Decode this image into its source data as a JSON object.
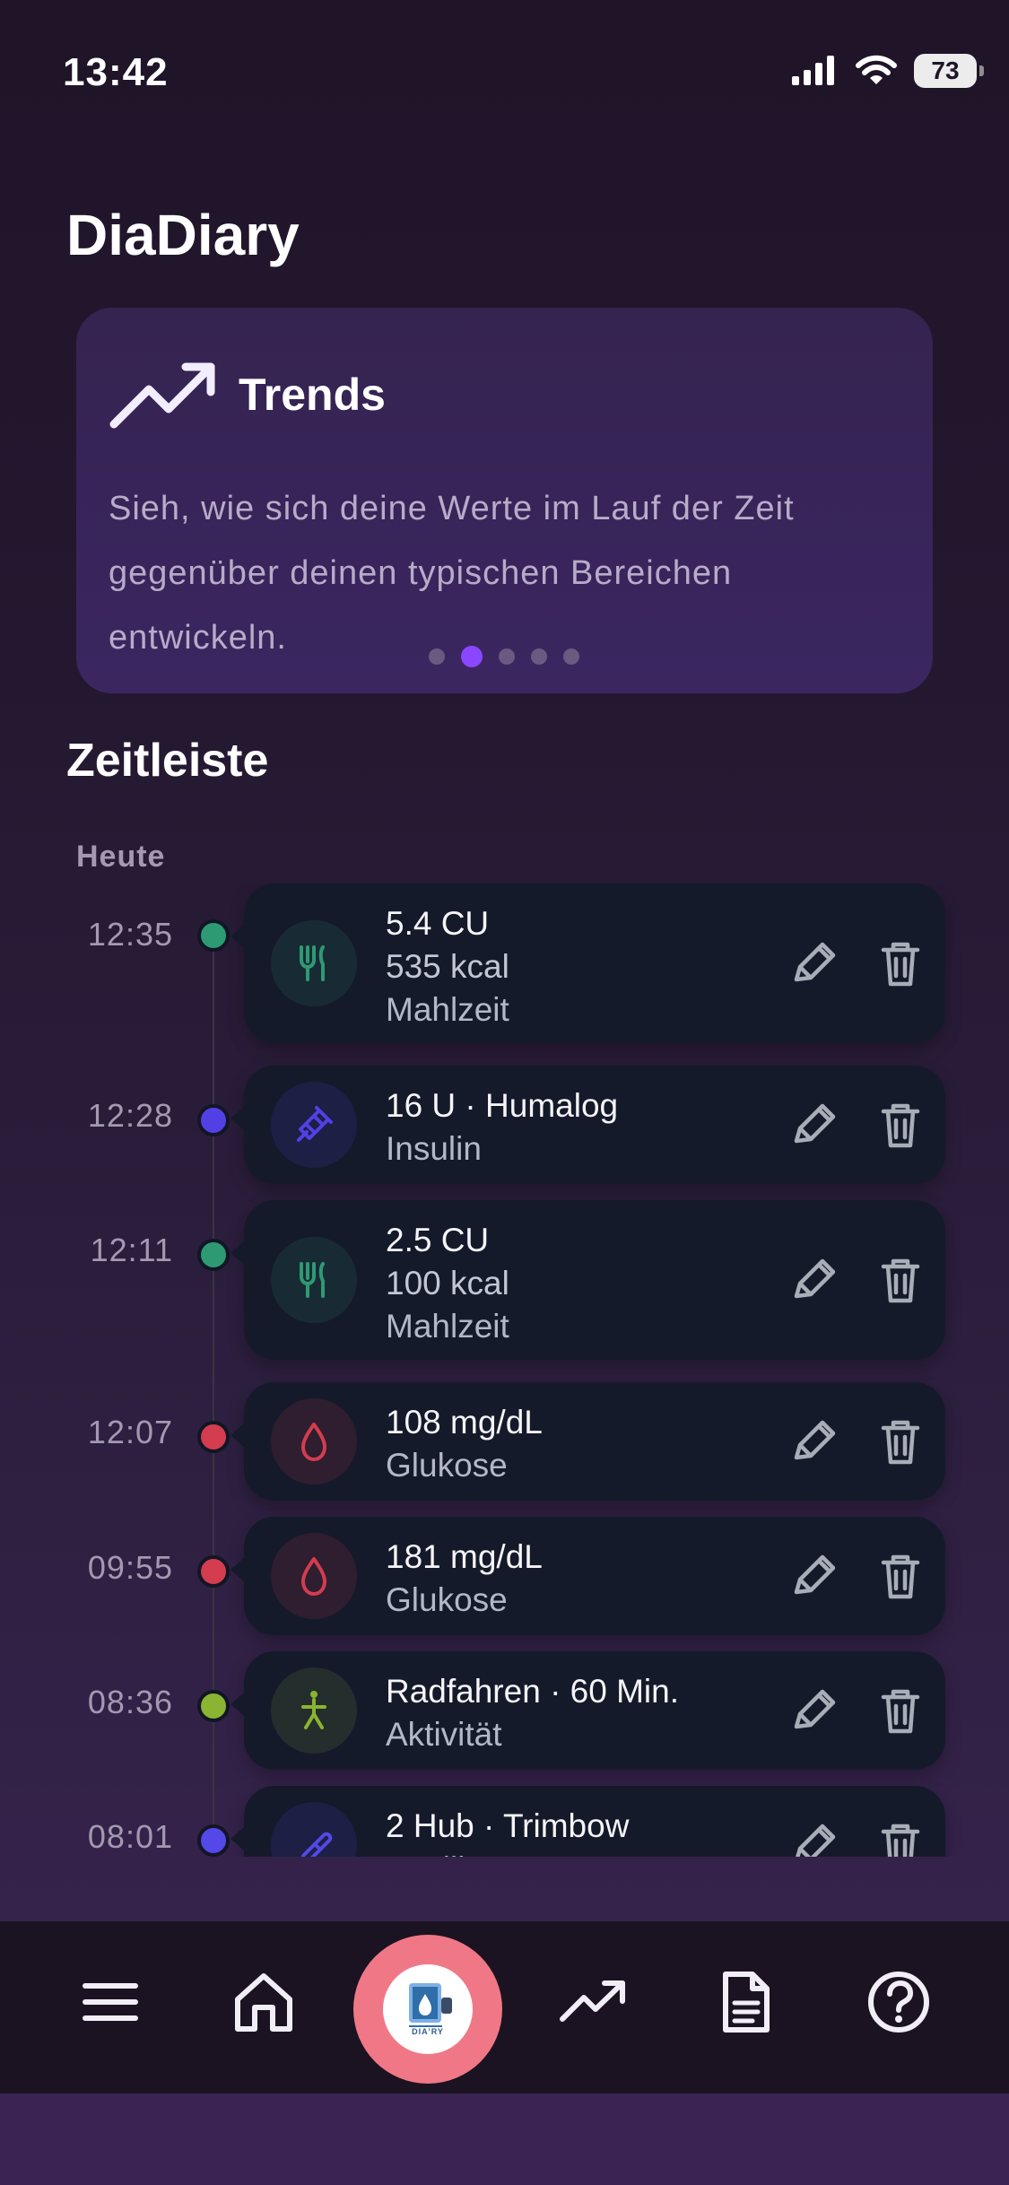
{
  "status_bar": {
    "time": "13:42",
    "battery": "73"
  },
  "app": {
    "title": "DiaDiary"
  },
  "trends_card": {
    "title": "Trends",
    "description": "Sieh, wie sich deine Werte im Lauf der Zeit gegenüber deinen typischen Bereichen entwickeln.",
    "page_count": 5,
    "active_page": 2
  },
  "timeline": {
    "title": "Zeitleiste",
    "day_label": "Heute",
    "entries": [
      {
        "time": "12:35",
        "icon": "fork-knife-icon",
        "color": "#2e9a73",
        "primary": "5.4 CU",
        "secondary": "535 kcal",
        "kind": "Mahlzeit"
      },
      {
        "time": "12:28",
        "icon": "syringe-icon",
        "color": "#5340e5",
        "primary": "16 U · Humalog",
        "secondary": "",
        "kind": "Insulin"
      },
      {
        "time": "12:11",
        "icon": "fork-knife-icon",
        "color": "#2e9a73",
        "primary": "2.5 CU",
        "secondary": "100 kcal",
        "kind": "Mahlzeit"
      },
      {
        "time": "12:07",
        "icon": "drop-icon",
        "color": "#d33d4f",
        "primary": "108 mg/dL",
        "secondary": "",
        "kind": "Glukose"
      },
      {
        "time": "09:55",
        "icon": "drop-icon",
        "color": "#d33d4f",
        "primary": "181 mg/dL",
        "secondary": "",
        "kind": "Glukose"
      },
      {
        "time": "08:36",
        "icon": "person-walking-icon",
        "color": "#8ab431",
        "primary": "Radfahren · 60 Min.",
        "secondary": "",
        "kind": "Aktivität"
      },
      {
        "time": "08:01",
        "icon": "pill-icon",
        "color": "#5448e9",
        "primary": "2 Hub · Trimbow",
        "secondary": "",
        "kind": "Medikament"
      }
    ]
  },
  "bottom_nav": {
    "items": [
      "menu-icon",
      "home-icon",
      "diary-logo",
      "trends-icon",
      "document-icon",
      "help-icon"
    ],
    "logo_text": "DIA'RY",
    "accent_color": "#f07886"
  },
  "theme": {
    "background": "#241830",
    "card": "#151a2b",
    "accent": "#8b47ff"
  }
}
